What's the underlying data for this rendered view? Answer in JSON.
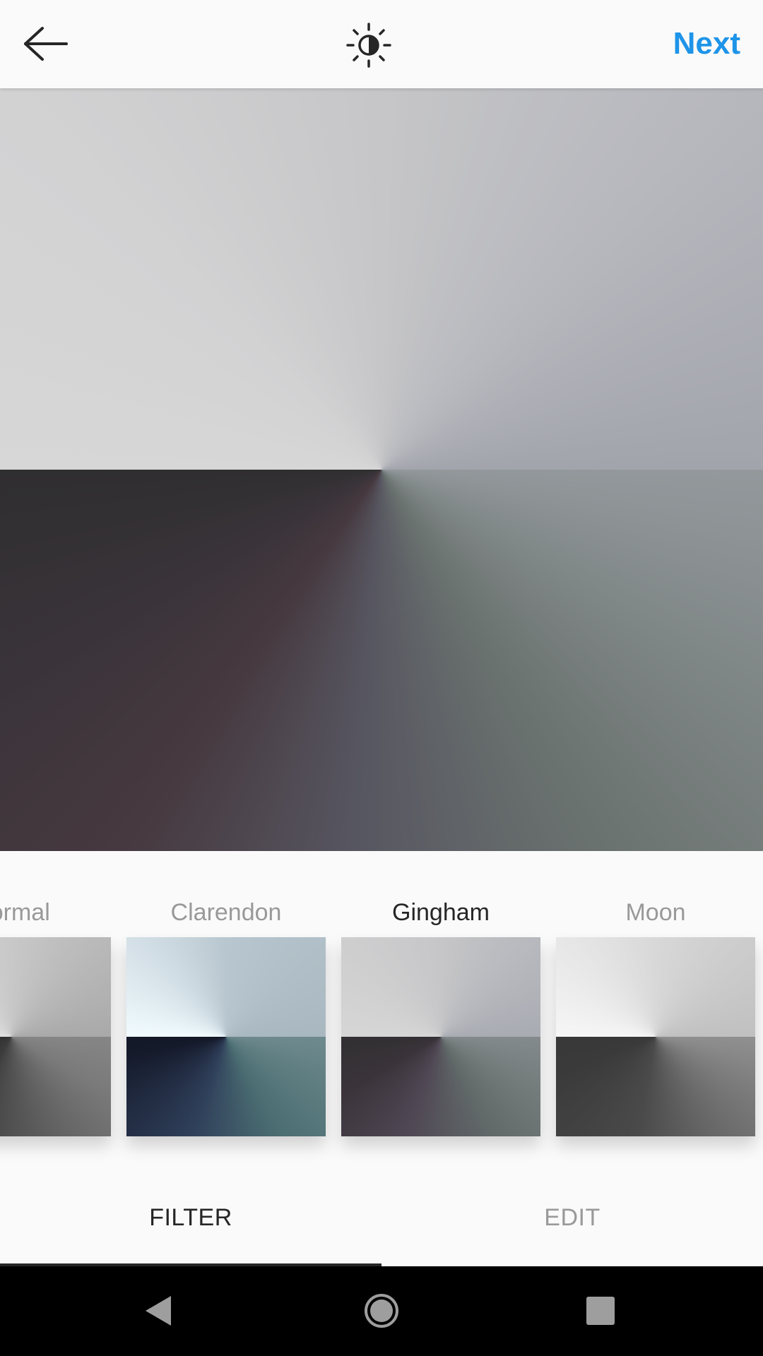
{
  "header": {
    "next_label": "Next",
    "back_icon": "arrow-left-icon",
    "adjust_icon": "brightness-contrast-icon",
    "accent_color": "#1e94e9"
  },
  "filters": [
    {
      "label": "Normal",
      "selected": false
    },
    {
      "label": "Clarendon",
      "selected": false
    },
    {
      "label": "Gingham",
      "selected": true
    },
    {
      "label": "Moon",
      "selected": false
    }
  ],
  "tabs": [
    {
      "label": "FILTER",
      "active": true
    },
    {
      "label": "EDIT",
      "active": false
    }
  ],
  "system_nav": {
    "back_icon": "nav-back-triangle-icon",
    "home_icon": "nav-home-circle-icon",
    "recents_icon": "nav-recents-square-icon"
  }
}
